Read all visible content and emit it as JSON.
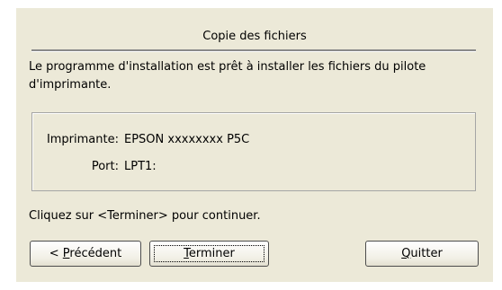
{
  "dialog": {
    "title": "Copie des fichiers",
    "description": "Le programme d'installation est prêt à installer les fichiers du pilote d'imprimante.",
    "info": {
      "printer_label": "Imprimante:",
      "printer_value": "EPSON xxxxxxxx P5C",
      "port_label": "Port:",
      "port_value": "LPT1:"
    },
    "prompt": "Cliquez sur <Terminer> pour continuer.",
    "buttons": {
      "previous": {
        "prefix": "< ",
        "mnemonic": "P",
        "rest": "récédent"
      },
      "finish": {
        "mnemonic": "T",
        "rest": "erminer"
      },
      "quit": {
        "mnemonic": "Q",
        "rest": "uitter"
      }
    }
  }
}
